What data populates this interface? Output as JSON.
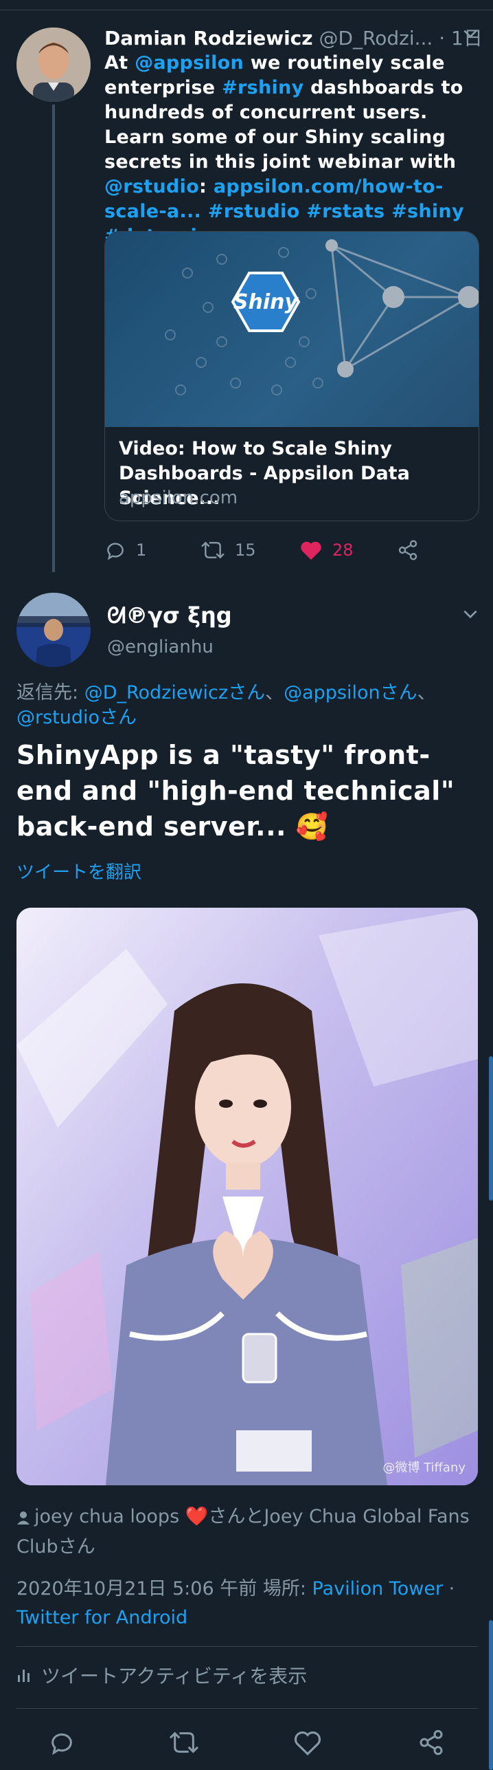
{
  "tweet1": {
    "name": "Damian Rodziewicz",
    "handle": "@D_Rodzi...",
    "time": "· 1日",
    "body": [
      {
        "t": "At ",
        "link": false
      },
      {
        "t": "@appsilon",
        "link": true
      },
      {
        "t": " we routinely scale enterprise ",
        "link": false
      },
      {
        "t": "#rshiny",
        "link": true
      },
      {
        "t": " dashboards to hundreds of concurrent users. Learn some of our Shiny scaling secrets in this joint webinar with ",
        "link": false
      },
      {
        "t": "@rstudio",
        "link": true
      },
      {
        "t": ": ",
        "link": false
      },
      {
        "t": "appsilon.com/how-to-scale-a...",
        "link": true
      },
      {
        "t": " ",
        "link": false
      },
      {
        "t": "#rstudio",
        "link": true
      },
      {
        "t": " ",
        "link": false
      },
      {
        "t": "#rstats",
        "link": true
      },
      {
        "t": " ",
        "link": false
      },
      {
        "t": "#shiny",
        "link": true
      },
      {
        "t": " ",
        "link": false
      },
      {
        "t": "#datascience",
        "link": true
      }
    ],
    "card": {
      "badge": "Shiny",
      "title": "Video: How to Scale Shiny Dashboards - Appsilon Data Science...",
      "domain": "appsilon.com"
    },
    "replies": "1",
    "retweets": "15",
    "likes": "28"
  },
  "tweet2": {
    "name": "ᘛ℗γσ ξηg",
    "handle": "@englianhu",
    "reply_to_prefix": "返信先: ",
    "reply_to": [
      {
        "t": "@D_Rodziewiczさん",
        "link": true
      },
      {
        "t": "、",
        "link": false
      },
      {
        "t": "@appsilonさん",
        "link": true
      },
      {
        "t": "、",
        "link": false
      },
      {
        "t": "@rstudioさん",
        "link": true
      }
    ],
    "text": "ShinyApp is a \"tasty\" front-end and \"high-end technical\" back-end server... 🥰",
    "translate": "ツイートを翻訳",
    "photo_watermark": "@微博 Tiffany",
    "liked_by": "joey chua loops ❤️さんとJoey Chua Global Fans Clubさん",
    "date": "2020年10月21日 5:06 午前",
    "place_label": " 場所: ",
    "place": "Pavilion Tower",
    "dot": " · ",
    "client": "Twitter for Android",
    "activity": "ツイートアクティビティを表示"
  },
  "colors": {
    "background": "#15202b",
    "link": "#1da1f2",
    "secondary": "#8899a6",
    "like": "#e0245e",
    "border": "#38444d"
  }
}
